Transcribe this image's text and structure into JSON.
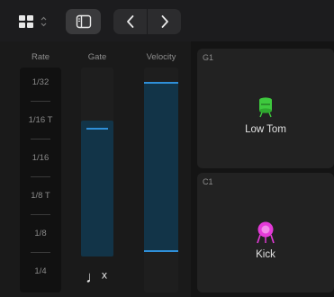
{
  "toolbar": {
    "grid_icon": "grid-icon",
    "inspector_icon": "sidebar-icon",
    "back_icon": "chevron-left-icon",
    "forward_icon": "chevron-right-icon"
  },
  "columns": {
    "rate_label": "Rate",
    "gate_label": "Gate",
    "velocity_label": "Velocity"
  },
  "rate_options": [
    "1/32",
    "1/16 T",
    "1/16",
    "1/8 T",
    "1/8",
    "1/4"
  ],
  "gate": {
    "level": 0.72,
    "note_symbol": "♩ˣ"
  },
  "velocity": {
    "level": 0.68
  },
  "pads": [
    {
      "note": "G1",
      "name": "Low Tom",
      "icon": "tom-drum-icon",
      "color": "#3ec93e"
    },
    {
      "note": "C1",
      "name": "Kick",
      "icon": "kick-drum-icon",
      "color": "#e43ad8"
    }
  ],
  "colors": {
    "accent": "#2f8fd8",
    "fill": "#123448"
  }
}
